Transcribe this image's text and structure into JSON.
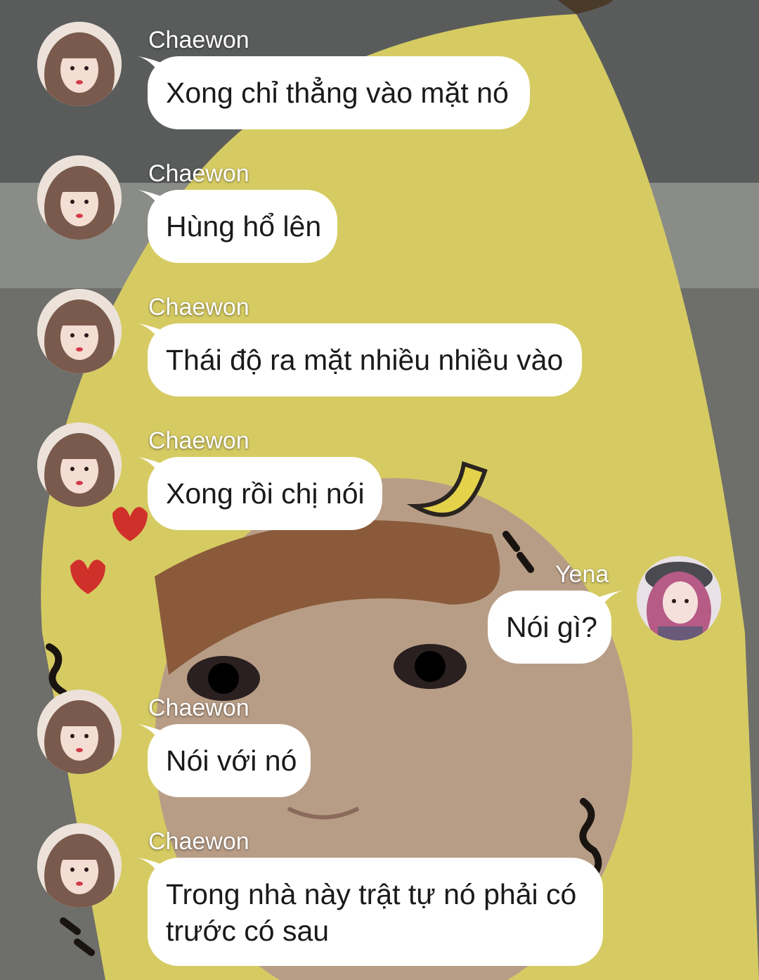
{
  "colors": {
    "bubble": "#ffffff",
    "sender_name": "#ffffff",
    "message_text": "#1a1a1a",
    "background_banana": "#d8cd6a"
  },
  "messages": [
    {
      "sender": "Chaewon",
      "side": "left",
      "avatar": "chaewon-avatar",
      "text": "Xong chỉ thẳng vào mặt nó"
    },
    {
      "sender": "Chaewon",
      "side": "left",
      "avatar": "chaewon-avatar",
      "text": "Hùng hổ lên"
    },
    {
      "sender": "Chaewon",
      "side": "left",
      "avatar": "chaewon-avatar",
      "text": "Thái độ ra mặt nhiều nhiều vào"
    },
    {
      "sender": "Chaewon",
      "side": "left",
      "avatar": "chaewon-avatar",
      "text": "Xong rồi chị nói"
    },
    {
      "sender": "Yena",
      "side": "right",
      "avatar": "yena-avatar",
      "text": "Nói gì?"
    },
    {
      "sender": "Chaewon",
      "side": "left",
      "avatar": "chaewon-avatar",
      "text": "Nói với nó"
    },
    {
      "sender": "Chaewon",
      "side": "left",
      "avatar": "chaewon-avatar",
      "text": "Trong nhà này trật tự nó phải có trước có sau"
    }
  ]
}
